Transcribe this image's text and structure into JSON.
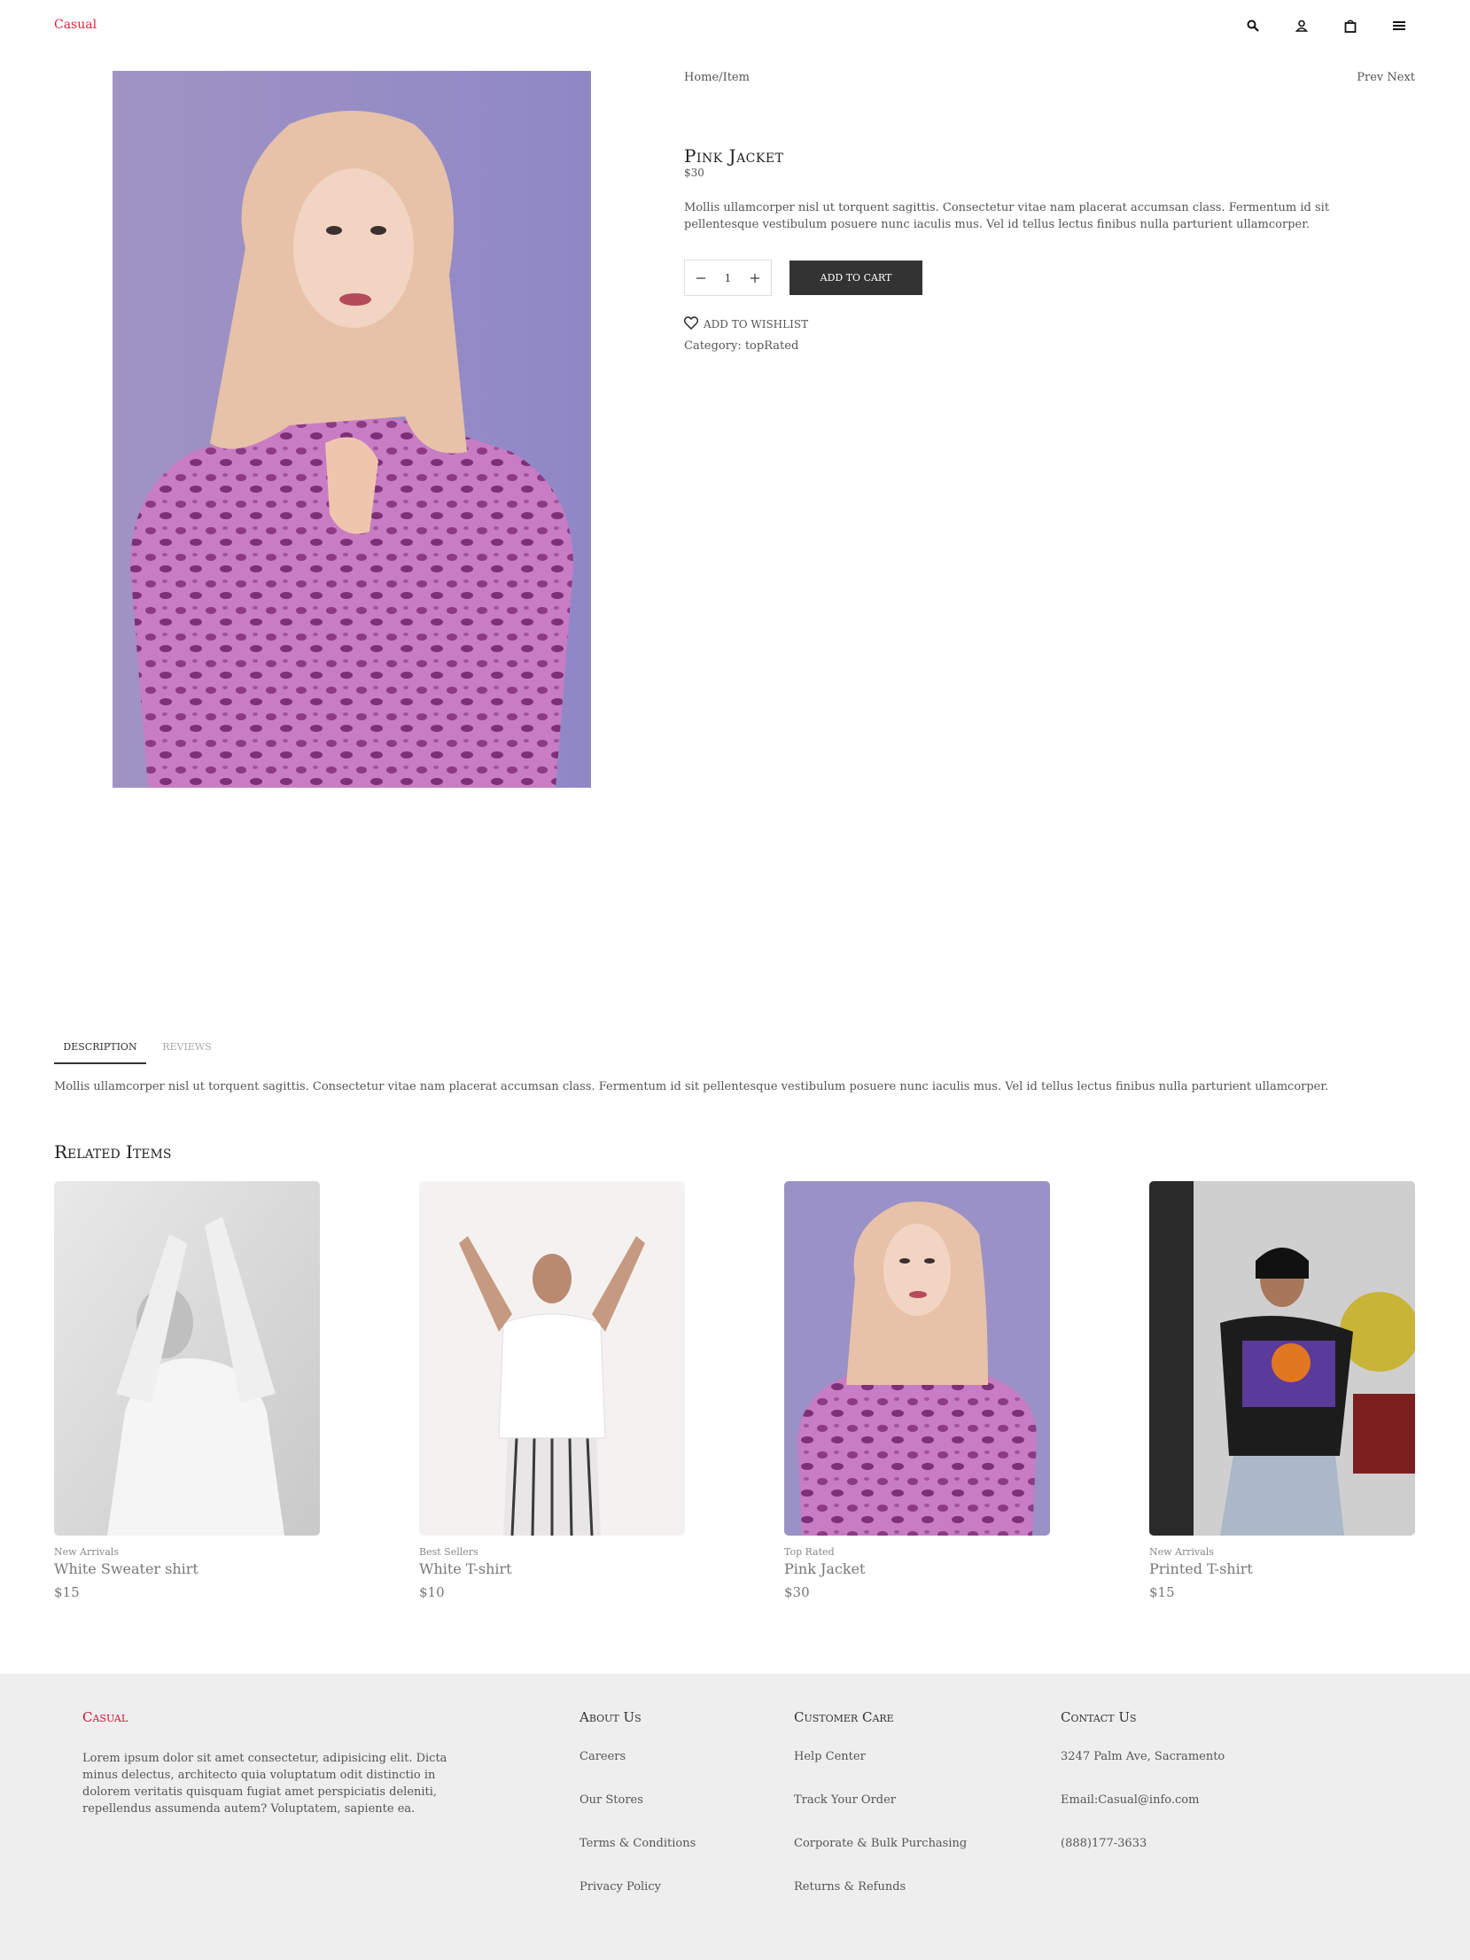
{
  "header": {
    "logo": "Casual",
    "icons": [
      "search-icon",
      "user-icon",
      "bag-icon",
      "menu-icon"
    ]
  },
  "product": {
    "breadcrumb": "Home/Item",
    "prev_label": "Prev",
    "next_label": "Next",
    "title": "Pink Jacket",
    "price": "$30",
    "description": "Mollis ullamcorper nisl ut torquent sagittis. Consectetur vitae nam placerat accumsan class. Fermentum id sit pellentesque vestibulum posuere nunc iaculis mus. Vel id tellus lectus finibus nulla parturient ullamcorper.",
    "quantity": "1",
    "add_to_cart": "ADD TO CART",
    "wishlist": "ADD TO WISHLIST",
    "category": "Category: topRated"
  },
  "tabs": {
    "items": [
      {
        "label": "DESCRIPTION",
        "active": true
      },
      {
        "label": "REVIEWS",
        "active": false
      }
    ],
    "content": "Mollis ullamcorper nisl ut torquent sagittis. Consectetur vitae nam placerat accumsan class. Fermentum id sit pellentesque vestibulum posuere nunc iaculis mus. Vel id tellus lectus finibus nulla parturient ullamcorper."
  },
  "related": {
    "title": "Related Items",
    "items": [
      {
        "category": "New Arrivals",
        "name": "White Sweater shirt",
        "price": "$15"
      },
      {
        "category": "Best Sellers",
        "name": "White T-shirt",
        "price": "$10"
      },
      {
        "category": "Top Rated",
        "name": "Pink Jacket",
        "price": "$30"
      },
      {
        "category": "New Arrivals",
        "name": "Printed T-shirt",
        "price": "$15"
      }
    ]
  },
  "footer": {
    "logo": "Casual",
    "about": "Lorem ipsum dolor sit amet consectetur, adipisicing elit. Dicta minus delectus, architecto quia voluptatum odit distinctio in dolorem veritatis quisquam fugiat amet perspiciatis deleniti, repellendus assumenda autem? Voluptatem, sapiente ea.",
    "about_us": {
      "heading": "About Us",
      "links": [
        "Careers",
        "Our Stores",
        "Terms & Conditions",
        "Privacy Policy"
      ]
    },
    "customer_care": {
      "heading": "Customer Care",
      "links": [
        "Help Center",
        "Track Your Order",
        "Corporate & Bulk Purchasing",
        "Returns & Refunds"
      ]
    },
    "contact": {
      "heading": "Contact Us",
      "lines": [
        "3247 Palm Ave, Sacramento",
        "Email:Casual@info.com",
        "(888)177-3633"
      ]
    }
  },
  "colors": {
    "brand": "#e0213d",
    "button": "#333333",
    "footer_bg": "#eeeeee"
  }
}
